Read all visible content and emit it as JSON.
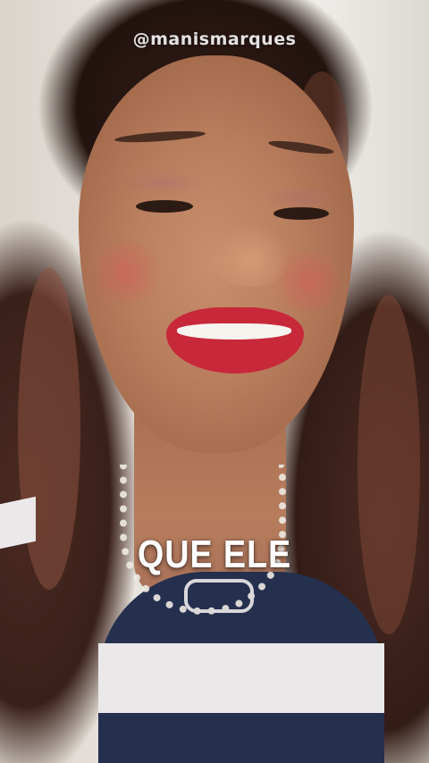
{
  "video": {
    "watermark": "@manismarques",
    "caption": "QUE ELE"
  },
  "colors": {
    "caption_text": "#ffffff",
    "lipstick": "#c7283a",
    "sweater_navy": "#24304e",
    "sweater_stripe": "#ebe8ea"
  }
}
